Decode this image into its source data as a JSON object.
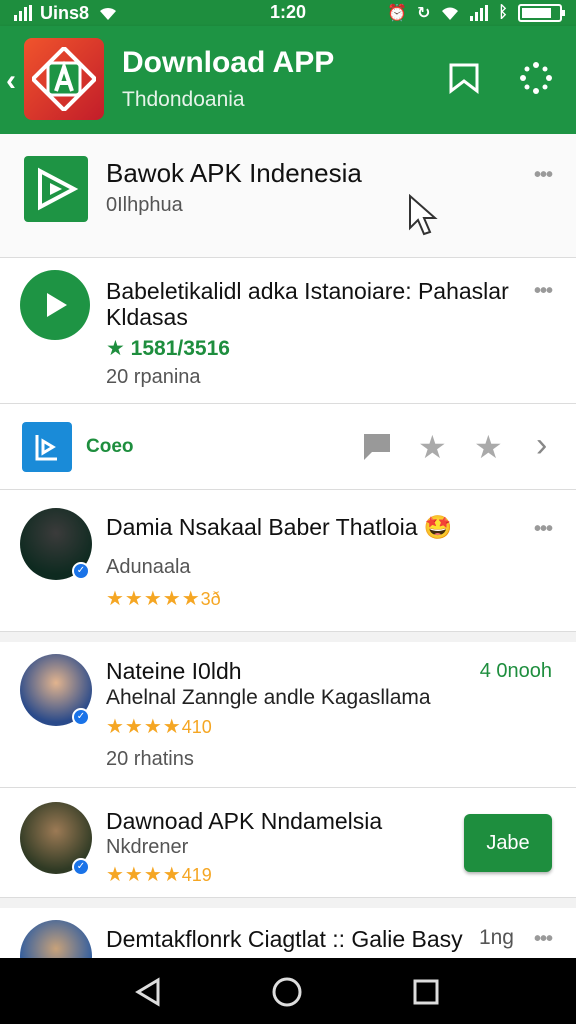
{
  "status_bar": {
    "carrier": "Uins8",
    "time": "1:20"
  },
  "app_bar": {
    "title": "Download APP",
    "subtitle": "Thdondoania",
    "actions": [
      "bookmark-icon",
      "more-dots-icon"
    ]
  },
  "header_row": {
    "title": "Bawok APK Indenesia",
    "subtitle": "0Ilhphua"
  },
  "featured_app": {
    "title_line1": "Babeletikalidl adka Istanoiare: Pahaslar",
    "title_line2": "Kldasas",
    "rating": "1581/3516",
    "reviews": "20 rpanina"
  },
  "action_strip": {
    "label": "Coeo"
  },
  "items": [
    {
      "title": "Damia Nsakaal Baber Thatloia",
      "emoji": "🤩",
      "subtitle": "Adunaala",
      "stars": "★★★★★",
      "rating": "3ð"
    },
    {
      "title": "Nateine I0ldh",
      "right_text": "4 0nooh",
      "subtitle": "Ahelnal Zanngle andle Kagasllama",
      "stars": "★★★★",
      "rating": "410",
      "reviews": "20 rhatins"
    },
    {
      "title": "Dawnoad APK Nndamelsia",
      "subtitle": "Nkdrener",
      "stars": "★★★★",
      "rating": "419",
      "button": "Jabe"
    },
    {
      "title": "Demtakflonrk Ciagtlat :: Galie Basy",
      "right_text": "1ng"
    }
  ],
  "colors": {
    "brand_green": "#1e9444",
    "star": "#f5a623",
    "rating_green": "#1e8e3e"
  }
}
